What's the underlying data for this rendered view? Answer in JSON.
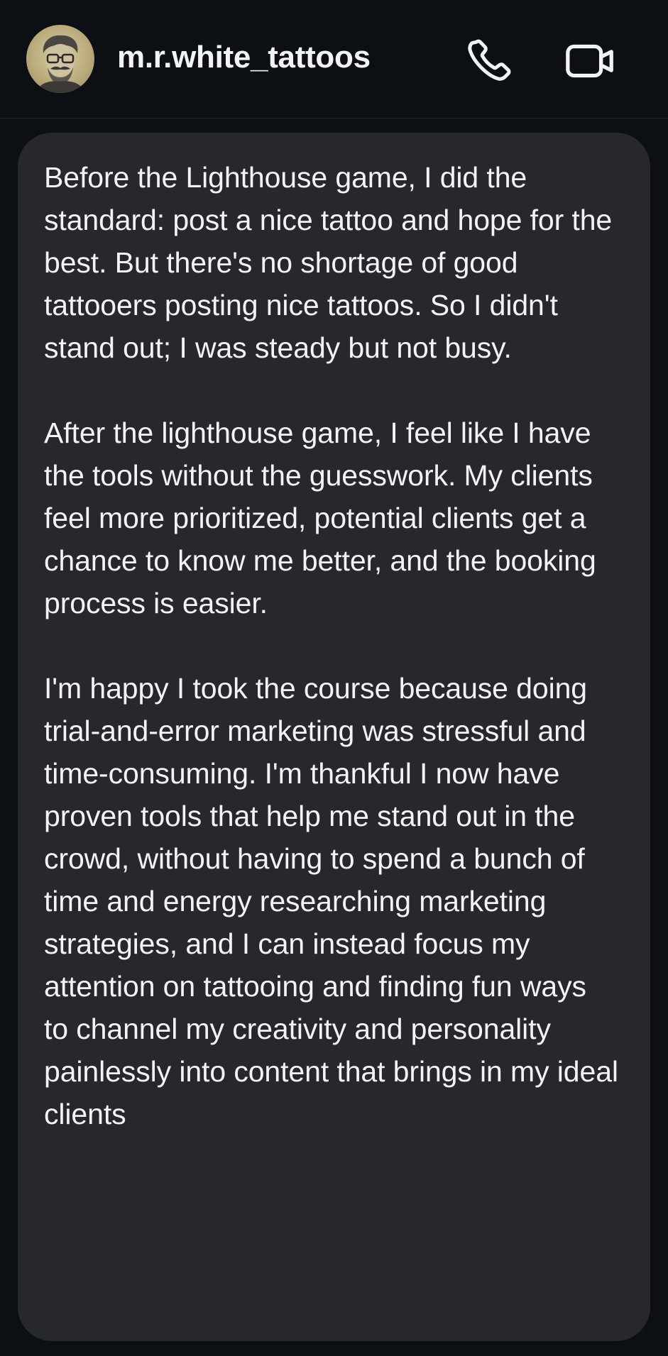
{
  "header": {
    "username": "m.r.white_tattoos",
    "avatar_icon": "cartoon-bearded-man-avatar",
    "call_icon": "phone-icon",
    "video_icon": "video-camera-icon"
  },
  "message": {
    "paragraphs": [
      "Before the Lighthouse game, I did the standard: post a nice tattoo and hope for the best. But there's no shortage of good tattooers posting nice tattoos. So I didn't stand out; I was steady but not busy.",
      "After the lighthouse game, I feel like I have the tools without the guesswork. My clients feel more prioritized, potential clients get a chance to know me better, and the booking process is easier.",
      "I'm happy I took the course because doing trial-and-error marketing was stressful and time-consuming. I'm thankful I now have proven tools that help me stand out in the crowd, without having to spend a bunch of time and energy researching marketing strategies, and I can instead focus my attention on tattooing and finding fun ways to channel my creativity and personality painlessly into content that brings in my ideal clients"
    ]
  },
  "colors": {
    "background": "#0c0f14",
    "bubble": "#26282d",
    "text": "#f2f3f5"
  }
}
